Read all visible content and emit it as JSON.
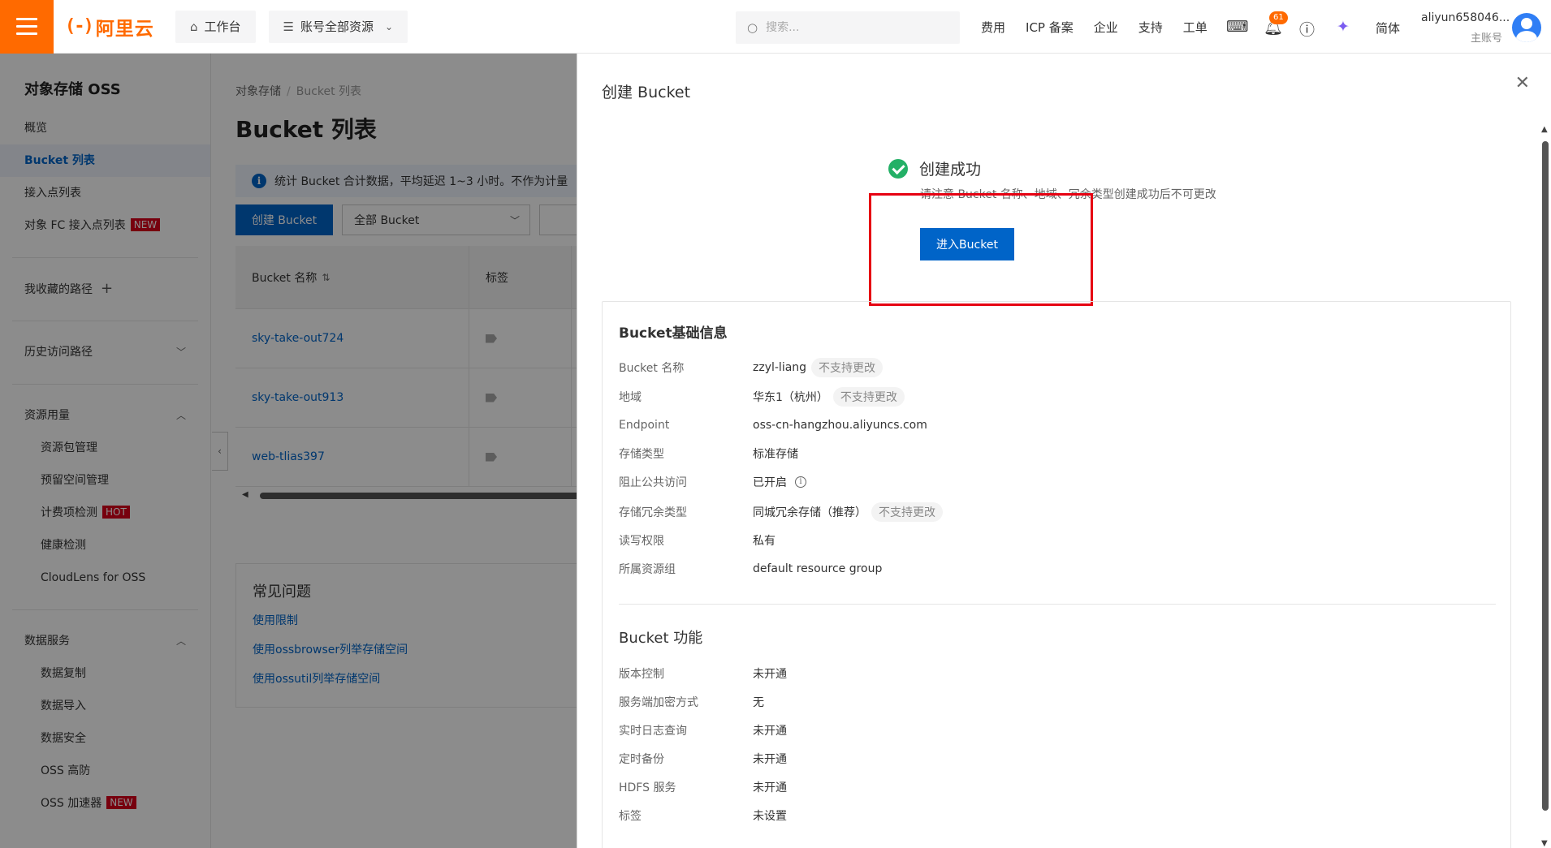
{
  "topbar": {
    "logo_text": "阿里云",
    "workbench": "工作台",
    "resources": "账号全部资源",
    "search_placeholder": "搜索...",
    "links": [
      "费用",
      "ICP 备案",
      "企业",
      "支持",
      "工单"
    ],
    "notification_count": "61",
    "language": "简体",
    "user_name": "aliyun658046...",
    "user_type": "主账号"
  },
  "sidebar": {
    "title": "对象存储 OSS",
    "items": [
      {
        "label": "概览"
      },
      {
        "label": "Bucket 列表"
      },
      {
        "label": "接入点列表"
      },
      {
        "label": "对象 FC 接入点列表",
        "tag": "NEW"
      }
    ],
    "favorites": "我收藏的路径",
    "history": "历史访问路径",
    "resource_usage": {
      "label": "资源用量",
      "items": [
        {
          "label": "资源包管理"
        },
        {
          "label": "预留空间管理"
        },
        {
          "label": "计费项检测",
          "tag": "HOT"
        },
        {
          "label": "健康检测"
        },
        {
          "label": "CloudLens for OSS"
        }
      ]
    },
    "data_services": {
      "label": "数据服务",
      "items": [
        {
          "label": "数据复制"
        },
        {
          "label": "数据导入"
        },
        {
          "label": "数据安全"
        },
        {
          "label": "OSS 高防"
        },
        {
          "label": "OSS 加速器",
          "tag": "NEW"
        }
      ]
    }
  },
  "main": {
    "breadcrumb": [
      "对象存储",
      "Bucket 列表"
    ],
    "title": "Bucket 列表",
    "info": "统计 Bucket 合计数据，平均延迟 1~3 小时。不作为计量",
    "create_button": "创建 Bucket",
    "filter_select": "全部 Bucket",
    "table": {
      "headers": [
        "Bucket 名称",
        "标签"
      ],
      "rows": [
        "sky-take-out724",
        "sky-take-out913",
        "web-tlias397"
      ]
    },
    "faq": {
      "title": "常见问题",
      "links": [
        "使用限制",
        "使用ossbrowser列举存储空间",
        "使用ossutil列举存储空间"
      ]
    }
  },
  "drawer": {
    "title": "创建 Bucket",
    "success_title": "创建成功",
    "success_note": "请注意 Bucket 名称、地域、冗余类型创建成功后不可更改",
    "enter_button": "进入Bucket",
    "basic": {
      "title": "Bucket基础信息",
      "rows": [
        {
          "label": "Bucket 名称",
          "value": "zzyl-liang",
          "note": "不支持更改"
        },
        {
          "label": "地域",
          "value": "华东1（杭州）",
          "note": "不支持更改"
        },
        {
          "label": "Endpoint",
          "value": "oss-cn-hangzhou.aliyuncs.com"
        },
        {
          "label": "存储类型",
          "value": "标准存储"
        },
        {
          "label": "阻止公共访问",
          "value": "已开启"
        },
        {
          "label": "存储冗余类型",
          "value": "同城冗余存储（推荐）",
          "note": "不支持更改"
        },
        {
          "label": "读写权限",
          "value": "私有"
        },
        {
          "label": "所属资源组",
          "value": "default resource group"
        }
      ]
    },
    "features": {
      "title": "Bucket 功能",
      "rows": [
        {
          "label": "版本控制",
          "value": "未开通"
        },
        {
          "label": "服务端加密方式",
          "value": "无"
        },
        {
          "label": "实时日志查询",
          "value": "未开通"
        },
        {
          "label": "定时备份",
          "value": "未开通"
        },
        {
          "label": "HDFS 服务",
          "value": "未开通"
        },
        {
          "label": "标签",
          "value": "未设置"
        }
      ]
    }
  },
  "colors": {
    "brand": "#ff6a00",
    "primary": "#0064c8",
    "success": "#23b066",
    "highlight": "#e60012"
  }
}
